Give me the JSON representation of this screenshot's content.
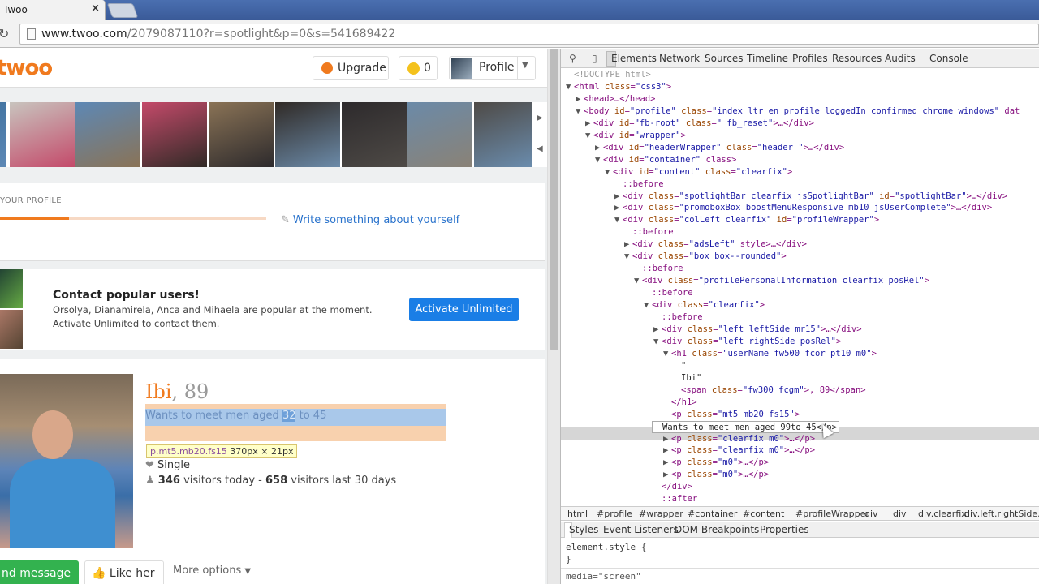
{
  "browser": {
    "tab_title": "Twoo",
    "tab_close": "×",
    "url_host": "www.twoo.com",
    "url_path": "/2079087110?r=spotlight&p=0&s=541689422"
  },
  "header": {
    "logo": "twoo",
    "upgrade_label": "Upgrade",
    "coins_count": "0",
    "profile_label": "Profile"
  },
  "spotlight": {
    "photos": [
      "#3b6e9c",
      "#c8c4be",
      "#5d88b5",
      "#c44a6a",
      "#8a7356",
      "#302a26",
      "#2d2a2c",
      "#6b8aa8",
      "#4e4a46",
      "#8a8276",
      "#6b8eb0"
    ]
  },
  "your_profile": {
    "title": "YOUR PROFILE",
    "progress": 0.26,
    "write_link": "Write something about yourself"
  },
  "contact": {
    "heading": "Contact popular users!",
    "description": "Orsolya, Dianamirela, Anca and Mihaela are popular at the moment. Activate Unlimited to contact them.",
    "activate_label": "Activate Unlimited"
  },
  "profile": {
    "name": "Ibi",
    "age": ", 89",
    "wants_pre": "Wants to meet men aged ",
    "wants_hl": "32",
    "wants_post": " to 45",
    "tooltip_class": "p.mt5.mb20.fs15",
    "tooltip_size": " 370px × 21px",
    "status": "Single",
    "visitors_today": "346",
    "visitors_today_label": " visitors today - ",
    "visitors_month": "658",
    "visitors_month_label": " visitors last 30 days",
    "send_message": "nd message",
    "like_label": "Like her",
    "more_options": "More options"
  },
  "devtools": {
    "tabs": [
      "Elements",
      "Network",
      "Sources",
      "Timeline",
      "Profiles",
      "Resources",
      "Audits",
      "Console"
    ],
    "tree": [
      {
        "i": 0,
        "t": "",
        "c": "cm",
        "s": "<!DOCTYPE html>"
      },
      {
        "i": 0,
        "t": "▼",
        "s": "<html class=\"css3\">"
      },
      {
        "i": 1,
        "t": "▶",
        "s": "<head>…</head>"
      },
      {
        "i": 1,
        "t": "▼",
        "s": "<body id=\"profile\" class=\"index ltr en profile loggedIn confirmed chrome windows\" dat"
      },
      {
        "i": 2,
        "t": "▶",
        "s": "<div id=\"fb-root\" class=\" fb_reset\">…</div>"
      },
      {
        "i": 2,
        "t": "▼",
        "s": "<div id=\"wrapper\">"
      },
      {
        "i": 3,
        "t": "▶",
        "s": "<div id=\"headerWrapper\" class=\"header \">…</div>"
      },
      {
        "i": 3,
        "t": "▼",
        "s": "<div id=\"container\" class>"
      },
      {
        "i": 4,
        "t": "▼",
        "s": "<div id=\"content\" class=\"clearfix\">"
      },
      {
        "i": 5,
        "t": "",
        "c": "ps",
        "s": "::before"
      },
      {
        "i": 5,
        "t": "▶",
        "s": "<div class=\"spotlightBar clearfix jsSpotlightBar\" id=\"spotlightBar\">…</div>"
      },
      {
        "i": 5,
        "t": "▶",
        "s": "<div class=\"promoboxBox boostMenuResponsive mb10 jsUserComplete\">…</div>"
      },
      {
        "i": 5,
        "t": "▼",
        "s": "<div class=\"colLeft clearfix\" id=\"profileWrapper\">"
      },
      {
        "i": 6,
        "t": "",
        "c": "ps",
        "s": "::before"
      },
      {
        "i": 6,
        "t": "▶",
        "s": "<div class=\"adsLeft\" style>…</div>"
      },
      {
        "i": 6,
        "t": "▼",
        "s": "<div class=\"box box--rounded\">"
      },
      {
        "i": 7,
        "t": "",
        "c": "ps",
        "s": "::before"
      },
      {
        "i": 7,
        "t": "▼",
        "s": "<div class=\"profilePersonalInformation clearfix posRel\">"
      },
      {
        "i": 8,
        "t": "",
        "c": "ps",
        "s": "::before"
      },
      {
        "i": 8,
        "t": "▼",
        "s": "<div class=\"clearfix\">"
      },
      {
        "i": 9,
        "t": "",
        "c": "ps",
        "s": "::before"
      },
      {
        "i": 9,
        "t": "▶",
        "s": "<div class=\"left leftSide mr15\">…</div>"
      },
      {
        "i": 9,
        "t": "▼",
        "s": "<div class=\"left rightSide posRel\">"
      },
      {
        "i": 10,
        "t": "▼",
        "s": "<h1 class=\"userName fw500 fcor pt10 m0\">"
      },
      {
        "i": 11,
        "t": "",
        "c": "tx",
        "s": "\""
      },
      {
        "i": 11,
        "t": "",
        "c": "tx",
        "s": "Ibi\""
      },
      {
        "i": 11,
        "t": "",
        "s": "<span class=\"fw300 fcgm\">, 89</span>"
      },
      {
        "i": 10,
        "t": "",
        "s": "</h1>"
      },
      {
        "i": 10,
        "t": "",
        "s": "<p class=\"mt5 mb20 fs15\">"
      },
      {
        "i": 10,
        "t": "",
        "c": "tx",
        "s": "Wants to meet men aged 99to 45</p>"
      },
      {
        "i": 10,
        "t": "▶",
        "s": "<p class=\"clearfix m0\">…</p>"
      },
      {
        "i": 10,
        "t": "▶",
        "s": "<p class=\"clearfix m0\">…</p>"
      },
      {
        "i": 10,
        "t": "▶",
        "s": "<p class=\"m0\">…</p>"
      },
      {
        "i": 10,
        "t": "▶",
        "s": "<p class=\"m0\">…</p>"
      },
      {
        "i": 9,
        "t": "",
        "s": "</div>"
      },
      {
        "i": 9,
        "t": "",
        "c": "ps",
        "s": "::after"
      }
    ],
    "breadcrumbs": [
      "html",
      "#profile",
      "#wrapper",
      "#container",
      "#content",
      "#profileWrapper",
      "div",
      "div",
      "div.clearfix",
      "div.left.rightSide.pos"
    ],
    "subtabs": [
      "Styles",
      "Event Listeners",
      "DOM Breakpoints",
      "Properties"
    ],
    "styles_line1": "element.style {",
    "styles_line2": "}",
    "styles_line3": "media=\"screen\""
  }
}
